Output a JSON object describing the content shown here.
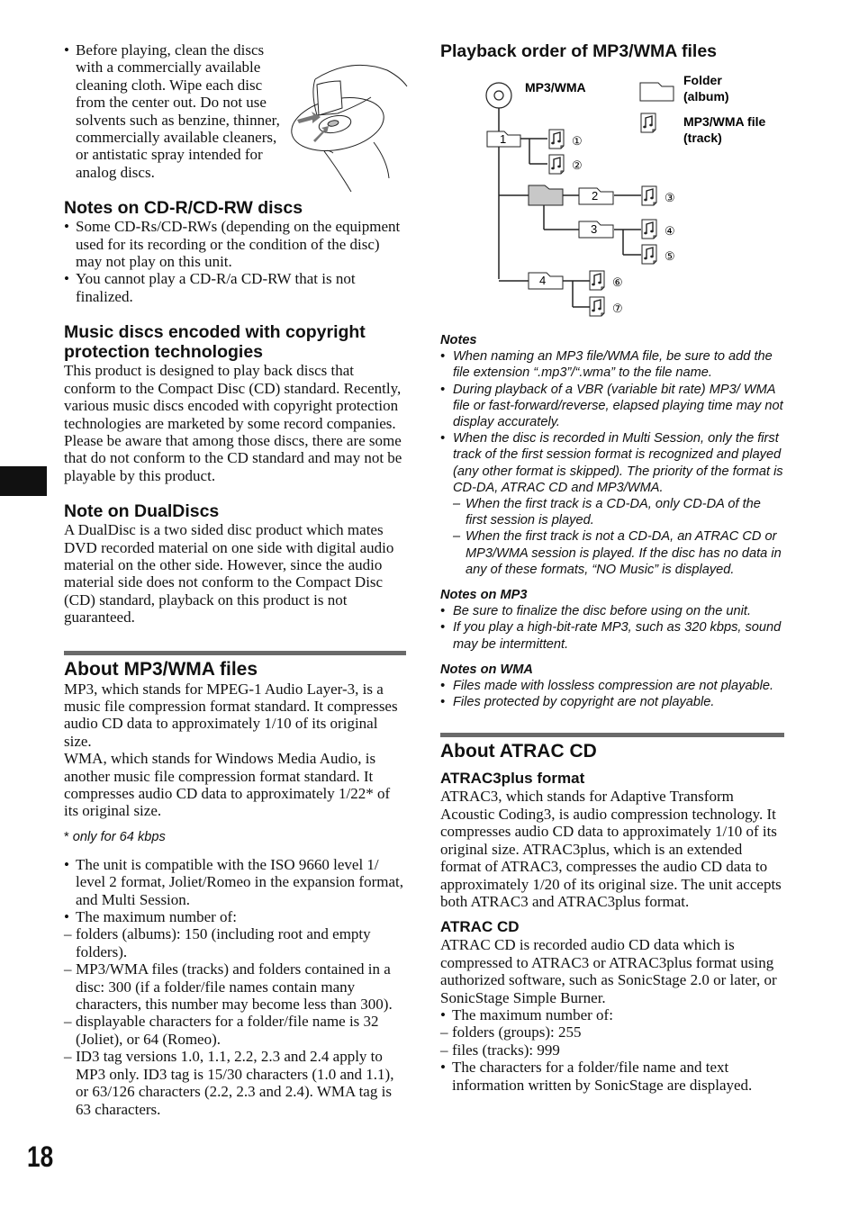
{
  "page": {
    "number": "18"
  },
  "left": {
    "cleaning_bullet": "Before playing, clean the discs with a commercially available cleaning cloth. Wipe each disc from the center out. Do not use solvents such as benzine, thinner, commercially available cleaners, or antistatic spray intended for analog discs.",
    "cdr": {
      "heading": "Notes on CD-R/CD-RW discs",
      "bullets": [
        "Some CD-Rs/CD-RWs (depending on the equipment used for its recording or the condition of the disc) may not play on this unit.",
        "You cannot play a CD-R/a CD-RW that is not finalized."
      ]
    },
    "copyright": {
      "heading": "Music discs encoded with copyright protection technologies",
      "body": "This product is designed to play back discs that conform to the Compact Disc (CD) standard. Recently, various music discs encoded with copyright protection technologies are marketed by some record companies. Please be aware that among those discs, there are some that do not conform to the CD standard and may not be playable by this product."
    },
    "dualdisc": {
      "heading": "Note on DualDiscs",
      "body": "A DualDisc is a two sided disc product which mates DVD recorded material on one side with digital audio material on the other side. However, since the audio material side does not conform to the Compact Disc (CD) standard, playback on this product is not guaranteed."
    },
    "mp3wma": {
      "heading": "About MP3/WMA files",
      "para1": "MP3, which stands for MPEG-1 Audio Layer-3, is a music file compression format standard. It compresses audio CD data to approximately 1/10 of its original size.",
      "para2": "WMA, which stands for Windows Media Audio, is another music file compression format standard. It compresses audio CD data to approximately 1/22* of its original size.",
      "footnote_mark": "*",
      "footnote": "only for 64 kbps",
      "bullet1": "The unit is compatible with the ISO 9660 level 1/ level 2 format, Joliet/Romeo in the expansion format, and Multi Session.",
      "bullet2": "The maximum number of:",
      "dashes": [
        "folders (albums): 150 (including root and empty folders).",
        "MP3/WMA files (tracks) and folders contained in a disc: 300 (if a folder/file names contain many characters, this number may become less than 300).",
        "displayable characters for a folder/file name is 32 (Joliet), or 64 (Romeo).",
        "ID3 tag versions 1.0, 1.1, 2.2, 2.3 and 2.4 apply to MP3 only. ID3 tag is 15/30 characters (1.0 and 1.1), or 63/126 characters (2.2, 2.3 and 2.4). WMA tag is 63 characters."
      ]
    }
  },
  "right": {
    "playback": {
      "heading": "Playback order of MP3/WMA files",
      "diagram": {
        "root_label": "MP3/WMA",
        "legend_folder": [
          "Folder",
          "(album)"
        ],
        "legend_file": [
          "MP3/WMA file",
          "(track)"
        ],
        "folders": [
          "1",
          "2",
          "3",
          "4"
        ],
        "tracks": [
          "①",
          "②",
          "③",
          "④",
          "⑤",
          "⑥",
          "⑦"
        ]
      }
    },
    "notes": {
      "heading": "Notes",
      "bullets": [
        "When naming an MP3 file/WMA file, be sure to add the file extension “.mp3”/“.wma” to the file name.",
        "During playback of a VBR (variable bit rate) MP3/ WMA file or fast-forward/reverse, elapsed playing time may not display accurately.",
        "When the disc is recorded in Multi Session, only the first track of the first session format is recognized and played (any other format is skipped). The priority of the format is CD-DA, ATRAC CD and MP3/WMA."
      ],
      "dashes": [
        "When the first track is a CD-DA, only CD-DA of the first session is played.",
        "When the first track is not a CD-DA, an ATRAC CD or MP3/WMA session is played. If the disc has no data in any of these formats, “NO Music” is displayed."
      ]
    },
    "notes_mp3": {
      "heading": "Notes on MP3",
      "bullets": [
        "Be sure to finalize the disc before using on the unit.",
        "If you play a high-bit-rate MP3, such as 320 kbps, sound may be intermittent."
      ]
    },
    "notes_wma": {
      "heading": "Notes on WMA",
      "bullets": [
        "Files made with lossless compression are not playable.",
        "Files protected by copyright are not playable."
      ]
    },
    "atrac": {
      "heading": "About ATRAC CD",
      "sub1": "ATRAC3plus format",
      "body1": "ATRAC3, which stands for Adaptive Transform Acoustic Coding3, is audio compression technology. It compresses audio CD data to approximately 1/10 of its original size. ATRAC3plus, which is an extended format of ATRAC3, compresses the audio CD data to approximately 1/20 of its original size. The unit accepts both ATRAC3 and ATRAC3plus format.",
      "sub2": "ATRAC CD",
      "body2": "ATRAC CD is recorded audio CD data which is compressed to ATRAC3 or ATRAC3plus format using authorized software, such as SonicStage 2.0 or later, or SonicStage Simple Burner.",
      "bullet1": "The maximum number of:",
      "dashes": [
        "folders (groups): 255",
        "files (tracks): 999"
      ],
      "bullet2": "The characters for a folder/file name and text information written by SonicStage are displayed."
    }
  },
  "colors": {
    "rule": "#6a6a6a",
    "folder_highlight": "#c8c8c8",
    "text": "#111111"
  }
}
